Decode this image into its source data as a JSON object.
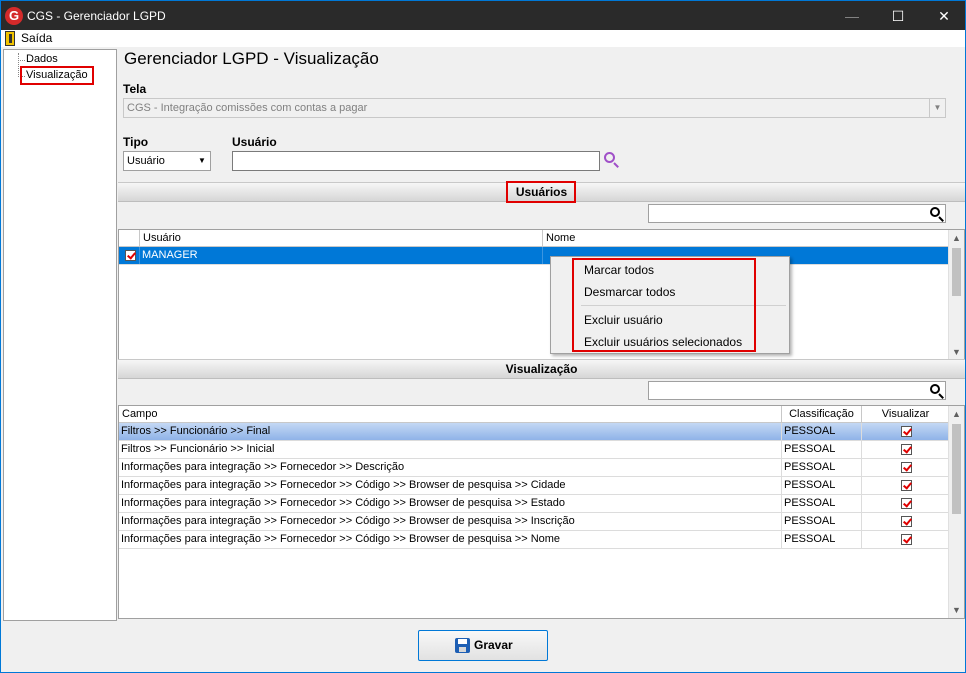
{
  "window": {
    "title": "CGS - Gerenciador LGPD",
    "app_icon_glyph": "G",
    "minimize": "—",
    "maximize": "☐",
    "close": "✕"
  },
  "menu": {
    "exit_label": "Saída"
  },
  "tree": {
    "items": [
      {
        "label": "Dados"
      },
      {
        "label": "Visualização"
      }
    ]
  },
  "page": {
    "title": "Gerenciador LGPD - Visualização"
  },
  "form": {
    "tela_label": "Tela",
    "tela_value": "CGS - Integração comissões com contas a pagar",
    "tipo_label": "Tipo",
    "tipo_value": "Usuário",
    "usuario_label": "Usuário",
    "usuario_value": ""
  },
  "usuarios_section": {
    "title": "Usuários",
    "columns": [
      "Usuário",
      "Nome"
    ],
    "rows": [
      {
        "usuario": "MANAGER",
        "nome": "",
        "checked": true,
        "selected": true
      }
    ]
  },
  "context_menu": {
    "items": [
      "Marcar todos",
      "Desmarcar todos",
      "Excluir usuário",
      "Excluir usuários selecionados"
    ]
  },
  "visualizacao_section": {
    "title": "Visualização",
    "columns": [
      "Campo",
      "Classificação",
      "Visualizar"
    ],
    "rows": [
      {
        "campo": "Filtros >> Funcionário >> Final",
        "classificacao": "PESSOAL",
        "visualizar": true,
        "selected": true
      },
      {
        "campo": "Filtros >> Funcionário >> Inicial",
        "classificacao": "PESSOAL",
        "visualizar": true
      },
      {
        "campo": "Informações para integração >> Fornecedor >> Descrição",
        "classificacao": "PESSOAL",
        "visualizar": true
      },
      {
        "campo": "Informações para integração >> Fornecedor >> Código >> Browser de pesquisa >> Cidade",
        "classificacao": "PESSOAL",
        "visualizar": true
      },
      {
        "campo": "Informações para integração >> Fornecedor >> Código >> Browser de pesquisa >> Estado",
        "classificacao": "PESSOAL",
        "visualizar": true
      },
      {
        "campo": "Informações para integração >> Fornecedor >> Código >> Browser de pesquisa >> Inscrição",
        "classificacao": "PESSOAL",
        "visualizar": true
      },
      {
        "campo": "Informações para integração >> Fornecedor >> Código >> Browser de pesquisa >> Nome",
        "classificacao": "PESSOAL",
        "visualizar": true
      }
    ]
  },
  "actions": {
    "save_label": "Gravar"
  },
  "colors": {
    "selection": "#0078d7",
    "highlight_box": "#e00000",
    "window_border": "#0078d7"
  }
}
